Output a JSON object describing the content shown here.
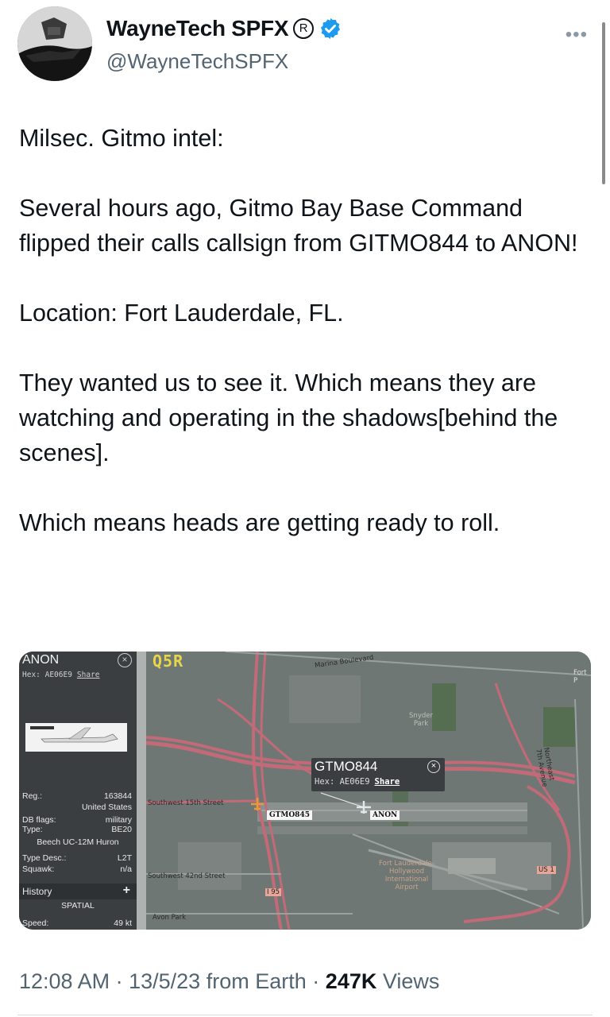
{
  "author": {
    "display_name": "WayneTech SPFX",
    "handle": "@WayneTechSPFX",
    "registered_mark": "R",
    "verified": true,
    "verified_color": "#1d9bf0"
  },
  "tweet": {
    "paragraphs": [
      "Milsec. Gitmo intel:",
      "Several hours ago, Gitmo Bay Base Command flipped their calls callsign from GITMO844 to ANON!",
      "Location: Fort Lauderdale, FL.",
      "They wanted us to see it. Which means they are watching and operating in the shadows[behind the scenes].",
      "Which means heads are getting ready to roll."
    ]
  },
  "media": {
    "panel": {
      "callsign": "ANON",
      "hex_label": "Hex: AE06E9",
      "share_label": "Share",
      "reg_label": "Reg.:",
      "reg_value": "163844",
      "country": "United States",
      "db_flags_label": "DB flags:",
      "db_flags_value": "military",
      "type_label": "Type:",
      "type_value": "BE20",
      "aircraft_name": "Beech UC-12M Huron",
      "type_desc_label": "Type Desc.:",
      "type_desc_value": "L2T",
      "squawk_label": "Squawk:",
      "squawk_value": "n/a",
      "history_label": "History",
      "history_toggle": "+",
      "spatial_label": "SPATIAL",
      "speed_label": "Speed:",
      "speed_value": "49 kt"
    },
    "logo_text": "Q5R",
    "popup": {
      "callsign": "GTMO844",
      "hex_label": "Hex: AE06E9",
      "share_label": "Share"
    },
    "aircraft_labels": [
      "GTMO845",
      "ANON"
    ],
    "map_labels": {
      "marina_blvd": "Marina Boulevard",
      "sw_15th": "Southwest 15th Street",
      "sw_42nd": "Southwest 42nd Street",
      "avon_park": "Avon Park",
      "snyder_park": "Snyder Park",
      "airport": "Fort Lauderdale-Hollywood International Airport",
      "i95": "I 95",
      "us1": "US 1",
      "ne_7th": "Northeast 7th Avenue",
      "fort_corner": "Fort P"
    },
    "colors": {
      "roads": "#c26a78",
      "background": "#6e7673",
      "panel": "#3a3e40",
      "logo": "#e8d64a"
    }
  },
  "meta": {
    "time": "12:08 AM",
    "date": "13/5/23",
    "source": "from Earth",
    "separator": "·",
    "views_count": "247K",
    "views_label": "Views"
  }
}
